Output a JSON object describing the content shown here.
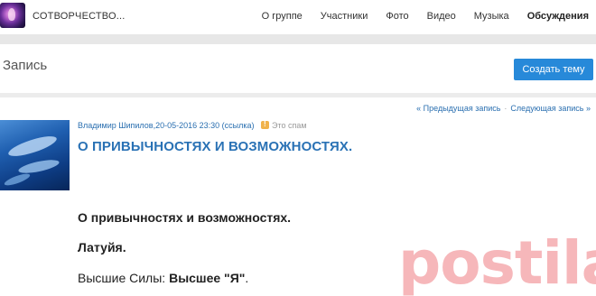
{
  "group": {
    "title": "СОТВОРЧЕСТВО..."
  },
  "nav": {
    "items": [
      "О группе",
      "Участники",
      "Фото",
      "Видео",
      "Музыка",
      "Обсуждения"
    ]
  },
  "section": {
    "title": "Запись",
    "create_button": "Создать тему"
  },
  "pager": {
    "prev": "« Предыдущая запись",
    "separator": "·",
    "next": "Следующая запись »"
  },
  "post": {
    "author": "Владимир Шипилов",
    "datetime": ",20-05-2016 23:30",
    "link": "(ссылка)",
    "spam": "Это спам",
    "title": "О ПРИВЫЧНОСТЯХ И ВОЗМОЖНОСТЯХ.",
    "body": {
      "line1": "О привычностях и возможностях.",
      "line2": "Латуйя.",
      "line3_prefix": "Высшие Силы: ",
      "line3_bold": "Высшее \"Я\"",
      "line3_suffix": "."
    }
  },
  "watermark": "postila.ru",
  "colors": {
    "accent": "#2789d9",
    "link": "#2a6fb0",
    "title": "#2a72b5",
    "watermark": "#e8434b"
  }
}
